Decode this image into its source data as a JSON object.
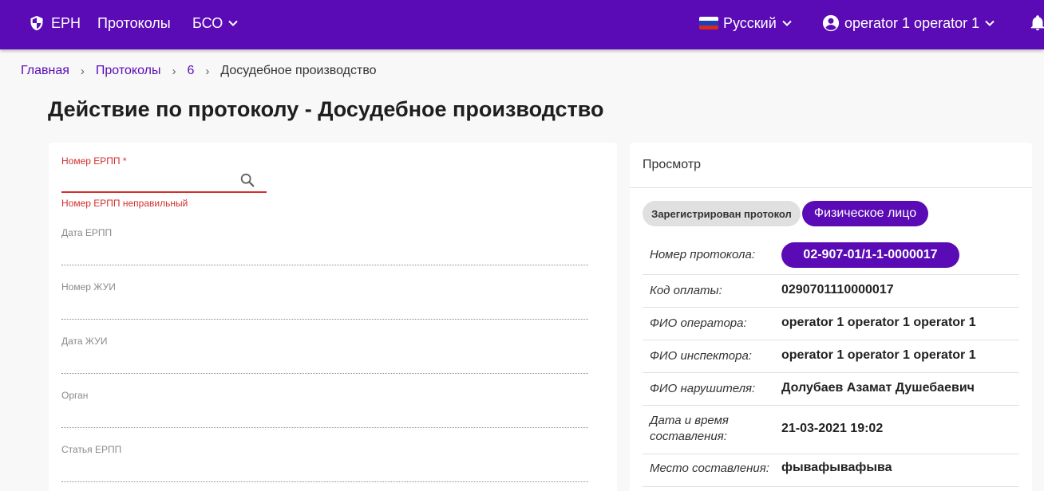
{
  "header": {
    "brand": "ЕРН",
    "nav_protocols": "Протоколы",
    "nav_bso": "БСО",
    "language": "Русский",
    "user": "operator 1 operator 1",
    "brand_color": "#5a0bb5"
  },
  "breadcrumb": {
    "home": "Главная",
    "protocols": "Протоколы",
    "id": "6",
    "current": "Досудебное производство"
  },
  "page_title": "Действие по протоколу - Досудебное производство",
  "form": {
    "erpp_number_label": "Номер ЕРПП *",
    "erpp_number_value": "",
    "erpp_number_error": "Номер ЕРПП неправильный",
    "erpp_date_label": "Дата ЕРПП",
    "zhui_number_label": "Номер ЖУИ",
    "zhui_date_label": "Дата ЖУИ",
    "organ_label": "Орган",
    "erpp_article_label": "Статья ЕРПП"
  },
  "preview": {
    "title": "Просмотр",
    "status_chip": "Зарегистрирован протокол",
    "person_chip": "Физическое лицо",
    "rows": [
      {
        "label": "Номер протокола:",
        "value": "02-907-01/1-1-0000017"
      },
      {
        "label": "Код оплаты:",
        "value": "0290701110000017"
      },
      {
        "label": "ФИО оператора:",
        "value": "operator 1 operator 1 operator 1"
      },
      {
        "label": "ФИО инспектора:",
        "value": "operator 1 operator 1 operator 1"
      },
      {
        "label": "ФИО нарушителя:",
        "value": "Долубаев Азамат Душебаевич"
      },
      {
        "label": "Дата и время составления:",
        "value": "21-03-2021 19:02"
      },
      {
        "label": "Место составления:",
        "value": "фывафывафыва"
      }
    ]
  }
}
